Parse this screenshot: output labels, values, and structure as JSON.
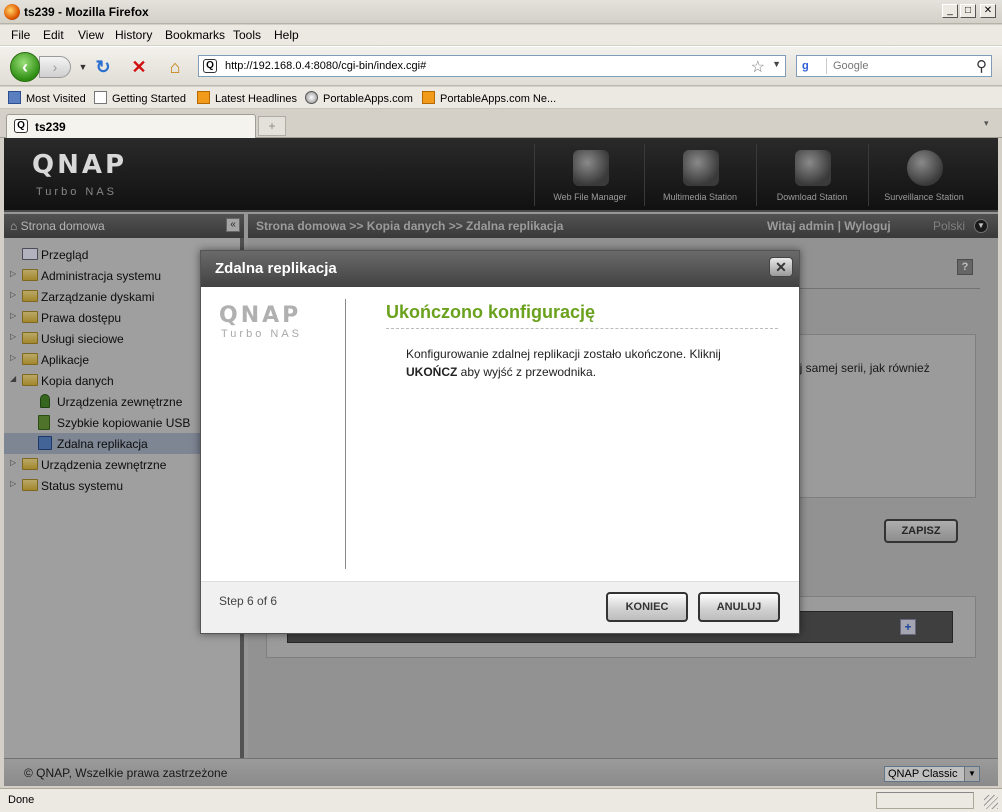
{
  "window": {
    "title": "ts239 - Mozilla Firefox",
    "min": "_",
    "max": "□",
    "close": "✕"
  },
  "menu": [
    "File",
    "Edit",
    "View",
    "History",
    "Bookmarks",
    "Tools",
    "Help"
  ],
  "nav": {
    "url": "http://192.168.0.4:8080/cgi-bin/index.cgi#",
    "search_placeholder": "Google",
    "search_engine": "g"
  },
  "bookmarks": [
    "Most Visited",
    "Getting Started",
    "Latest Headlines",
    "PortableApps.com",
    "PortableApps.com Ne..."
  ],
  "tab": {
    "label": "ts239",
    "new": "+"
  },
  "qnap": {
    "logo": "QNAP",
    "sub": "Turbo NAS",
    "apps": [
      "Web File Manager",
      "Multimedia Station",
      "Download Station",
      "Surveillance Station"
    ]
  },
  "sidebar": {
    "title": "Strona domowa",
    "items": [
      {
        "label": "Przegląd"
      },
      {
        "label": "Administracja systemu"
      },
      {
        "label": "Zarządzanie dyskami"
      },
      {
        "label": "Prawa dostępu"
      },
      {
        "label": "Usługi sieciowe"
      },
      {
        "label": "Aplikacje"
      },
      {
        "label": "Kopia danych"
      },
      {
        "label": "Urządzenia zewnętrzne"
      },
      {
        "label": "Szybkie kopiowanie USB"
      },
      {
        "label": "Zdalna replikacja"
      },
      {
        "label": "Urządzenia zewnętrzne"
      },
      {
        "label": "Status systemu"
      }
    ]
  },
  "main": {
    "breadcrumb": "Strona domowa >> Kopia danych >> Zdalna replikacja",
    "user": "Witaj admin | Wyloguj",
    "language": "Polski",
    "bg_text": "ej samej serii, jak również",
    "save": "ZAPISZ",
    "help": "?",
    "add": "+"
  },
  "footer": {
    "copyright": "© QNAP, Wszelkie prawa zastrzeżone",
    "theme": "QNAP Classic"
  },
  "dialog": {
    "title": "Zdalna replikacja",
    "close": "✕",
    "logo": "QNAP",
    "logo_sub": "Turbo NAS",
    "heading": "Ukończono konfigurację",
    "text1": "Konfigurowanie zdalnej replikacji zostało ukończone. Kliknij",
    "text_bold": "UKOŃCZ",
    "text2": " aby wyjść z przewodnika.",
    "step": "Step 6 of 6",
    "finish": "KONIEC",
    "cancel": "ANULUJ"
  },
  "status": {
    "text": "Done"
  }
}
